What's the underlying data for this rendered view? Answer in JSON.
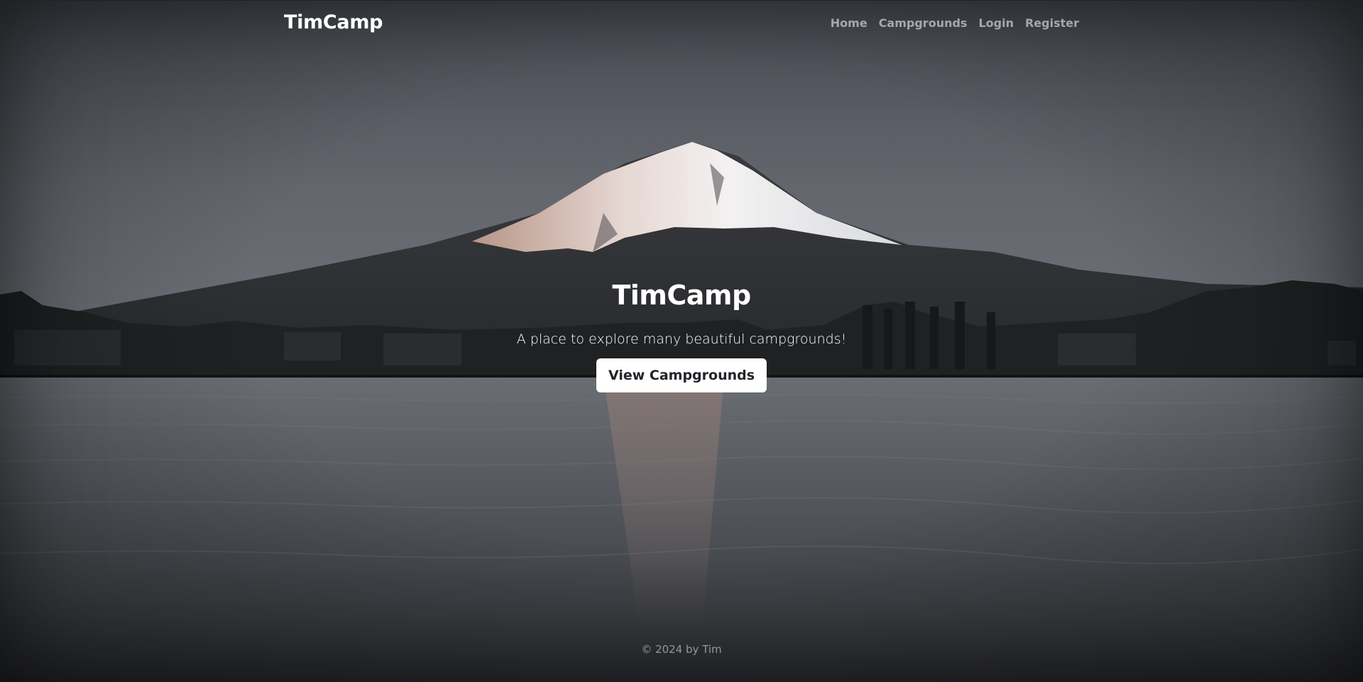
{
  "navbar": {
    "brand": "TimCamp",
    "links": [
      {
        "label": "Home"
      },
      {
        "label": "Campgrounds"
      },
      {
        "label": "Login"
      },
      {
        "label": "Register"
      }
    ]
  },
  "hero": {
    "title": "TimCamp",
    "lead": "A place to explore many beautiful campgrounds!",
    "button_label": "View Campgrounds"
  },
  "footer": {
    "text": "© 2024 by Tim"
  },
  "colors": {
    "sky_top": "#4b4f57",
    "sky_bottom": "#6d7077",
    "water": "#5a5d63",
    "snow": "#f1ecea",
    "alpenglow": "#c9a59a",
    "button_bg": "#ffffff",
    "button_text": "#212529"
  }
}
